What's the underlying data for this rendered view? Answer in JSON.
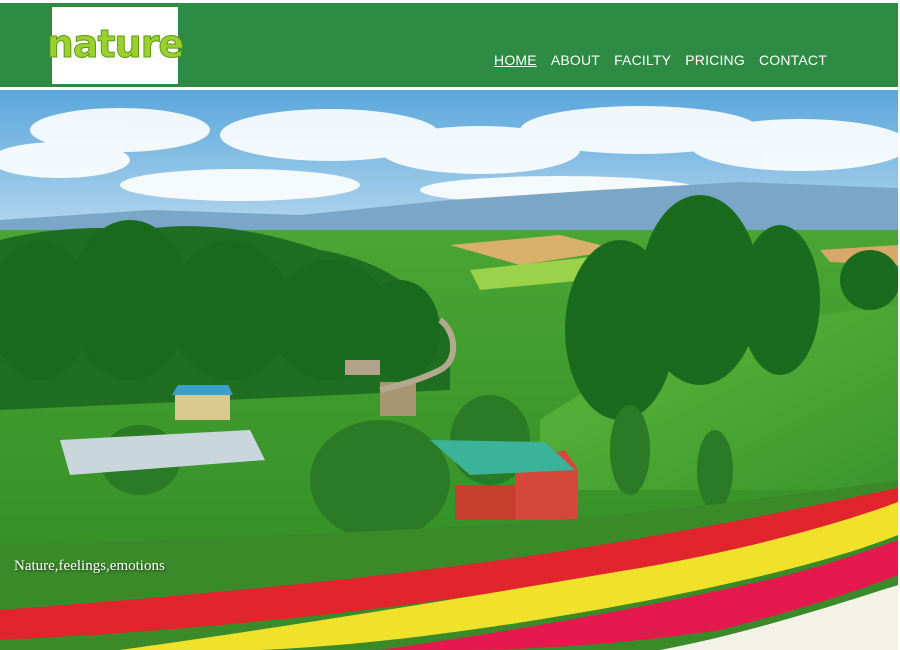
{
  "header": {
    "logo_text": "nature",
    "nav": [
      "HOME",
      "ABOUT",
      "FACILTY",
      "PRICING",
      "CONTACT"
    ],
    "active_nav": "HOME"
  },
  "hero": {
    "tagline": "Nature,feelings,emotions"
  },
  "colors": {
    "header_bg": "#2e8b43",
    "nav_text": "#ffffff",
    "logo_green": "#9bd12f"
  }
}
